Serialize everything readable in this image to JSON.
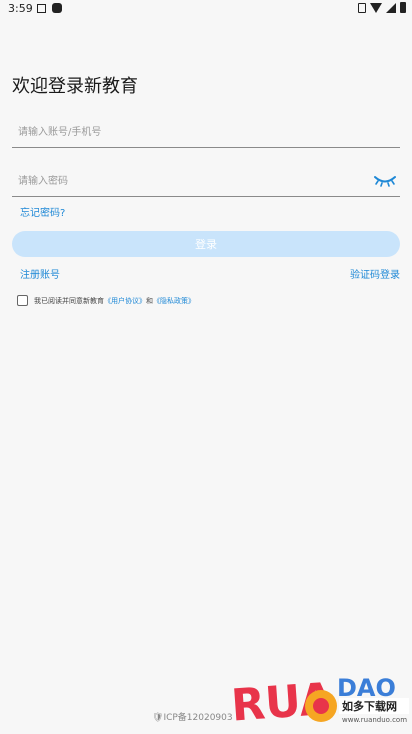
{
  "status_bar": {
    "time": "3:59"
  },
  "page": {
    "title": "欢迎登录新教育"
  },
  "form": {
    "account_placeholder": "请输入账号/手机号",
    "password_placeholder": "请输入密码",
    "forgot_password": "忘记密码?",
    "login_button": "登录",
    "register": "注册账号",
    "sms_login": "验证码登录"
  },
  "agreement": {
    "prefix": "我已阅读并同意新教育",
    "user_agreement": "《用户协议》",
    "and": "和",
    "privacy_policy": "《隐私政策》"
  },
  "footer": {
    "icp": "ICP备12020903"
  },
  "watermark": {
    "logo_text": "RUANDAO",
    "site_name": "如多下载网",
    "url": "www.ruanduo.com"
  },
  "colors": {
    "accent": "#1e88d6",
    "login_button_bg": "#c9e4fb",
    "background": "#f7f7f7"
  }
}
